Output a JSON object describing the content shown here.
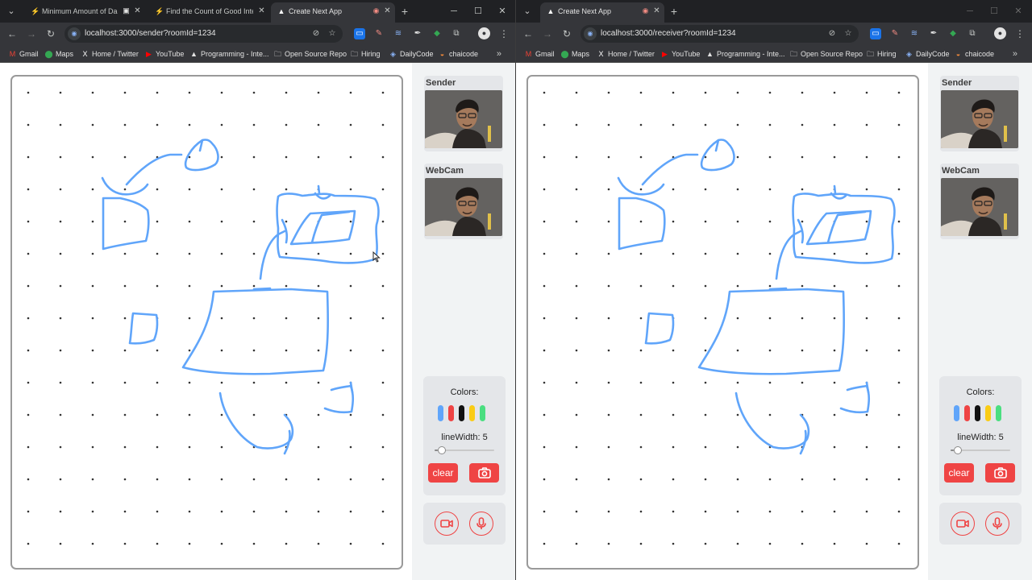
{
  "left_window": {
    "tabs": [
      {
        "title": "Minimum Amount of Damage Dealt",
        "favicon": "leetcode-icon",
        "active": false
      },
      {
        "title": "Find the Count of Good Integers",
        "favicon": "leetcode-icon",
        "active": false
      },
      {
        "title": "Create Next App",
        "favicon": "nextjs-icon",
        "active": true
      }
    ],
    "url": "localhost:3000/sender?roomId=1234"
  },
  "right_window": {
    "tabs": [
      {
        "title": "Create Next App",
        "favicon": "nextjs-icon",
        "active": true
      }
    ],
    "url": "localhost:3000/receiver?roomId=1234"
  },
  "bookmarks": [
    {
      "label": "Gmail",
      "icon": "gmail-icon"
    },
    {
      "label": "Maps",
      "icon": "maps-icon"
    },
    {
      "label": "Home / Twitter",
      "icon": "x-icon"
    },
    {
      "label": "YouTube",
      "icon": "youtube-icon"
    },
    {
      "label": "Programming - Inte...",
      "icon": "programming-icon"
    },
    {
      "label": "Open Source Repo",
      "icon": "folder-icon"
    },
    {
      "label": "Hiring",
      "icon": "folder-icon"
    },
    {
      "label": "DailyCode",
      "icon": "dailycode-icon"
    },
    {
      "label": "chaicode",
      "icon": "chaicode-icon"
    }
  ],
  "sidebar": {
    "sender_label": "Sender",
    "webcam_label": "WebCam",
    "colors_label": "Colors:",
    "line_width_label": "lineWidth: 5",
    "line_width": 5,
    "line_width_fraction": 0.05,
    "clear_label": "clear",
    "colors": [
      "#60a5fa",
      "#ef4444",
      "#111111",
      "#facc15",
      "#4ade80"
    ]
  },
  "stroke_color": "#60a5fa"
}
